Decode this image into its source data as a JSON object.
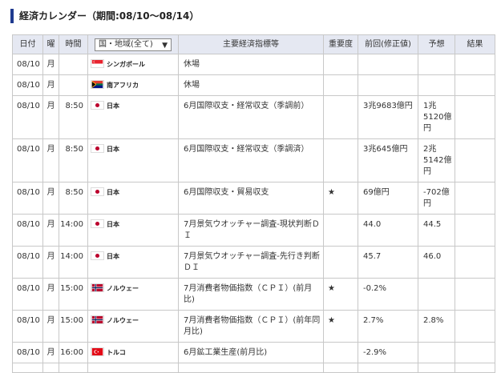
{
  "page": {
    "title": "経済カレンダー（期間:08/10〜08/14）"
  },
  "table": {
    "headers": {
      "date": "日付",
      "dow": "曜",
      "time": "時間",
      "region_select": "国・地域(全て)",
      "indicator": "主要経済指標等",
      "importance": "重要度",
      "previous": "前回(修正値)",
      "forecast": "予想",
      "result": "結果"
    },
    "rows": [
      {
        "date": "08/10",
        "dow": "月",
        "time": "",
        "country": "シンガポール",
        "flag": "singapore-flag-icon",
        "indicator": "休場",
        "importance": "",
        "previous": "",
        "forecast": "",
        "result": ""
      },
      {
        "date": "08/10",
        "dow": "月",
        "time": "",
        "country": "南アフリカ",
        "flag": "south-africa-flag-icon",
        "indicator": "休場",
        "importance": "",
        "previous": "",
        "forecast": "",
        "result": ""
      },
      {
        "date": "08/10",
        "dow": "月",
        "time": "8:50",
        "country": "日本",
        "flag": "japan-flag-icon",
        "indicator": "6月国際収支・経常収支（季調前）",
        "importance": "",
        "previous": "3兆9683億円",
        "forecast": "1兆5120億円",
        "result": ""
      },
      {
        "date": "08/10",
        "dow": "月",
        "time": "8:50",
        "country": "日本",
        "flag": "japan-flag-icon",
        "indicator": "6月国際収支・経常収支（季調済）",
        "importance": "",
        "previous": "3兆645億円",
        "forecast": "2兆5142億円",
        "result": ""
      },
      {
        "date": "08/10",
        "dow": "月",
        "time": "8:50",
        "country": "日本",
        "flag": "japan-flag-icon",
        "indicator": "6月国際収支・貿易収支",
        "importance": "★",
        "previous": "69億円",
        "forecast": "-702億円",
        "result": ""
      },
      {
        "date": "08/10",
        "dow": "月",
        "time": "14:00",
        "country": "日本",
        "flag": "japan-flag-icon",
        "indicator": "7月景気ウオッチャー調査-現状判断ＤＩ",
        "importance": "",
        "previous": "44.0",
        "forecast": "44.5",
        "result": ""
      },
      {
        "date": "08/10",
        "dow": "月",
        "time": "14:00",
        "country": "日本",
        "flag": "japan-flag-icon",
        "indicator": "7月景気ウオッチャー調査-先行き判断ＤＩ",
        "importance": "",
        "previous": "45.7",
        "forecast": "46.0",
        "result": ""
      },
      {
        "date": "08/10",
        "dow": "月",
        "time": "15:00",
        "country": "ノルウェー",
        "flag": "norway-flag-icon",
        "indicator": "7月消費者物価指数（ＣＰＩ）(前月比)",
        "importance": "★",
        "previous": "-0.2%",
        "forecast": "",
        "result": ""
      },
      {
        "date": "08/10",
        "dow": "月",
        "time": "15:00",
        "country": "ノルウェー",
        "flag": "norway-flag-icon",
        "indicator": "7月消費者物価指数（ＣＰＩ）(前年同月比)",
        "importance": "★",
        "previous": "2.7%",
        "forecast": "2.8%",
        "result": ""
      },
      {
        "date": "08/10",
        "dow": "月",
        "time": "16:00",
        "country": "トルコ",
        "flag": "turkey-flag-icon",
        "indicator": "6月鉱工業生産(前月比)",
        "importance": "",
        "previous": "-2.9%",
        "forecast": "",
        "result": ""
      },
      {
        "date": "",
        "dow": "",
        "time": "",
        "country": "",
        "flag": "",
        "indicator": "",
        "importance": "",
        "previous": "",
        "forecast": "",
        "result": ""
      }
    ]
  },
  "colors": {
    "title_accent": "#1f3a8f",
    "header_bg": "#e5e8f2",
    "border": "#c8c8c8"
  }
}
